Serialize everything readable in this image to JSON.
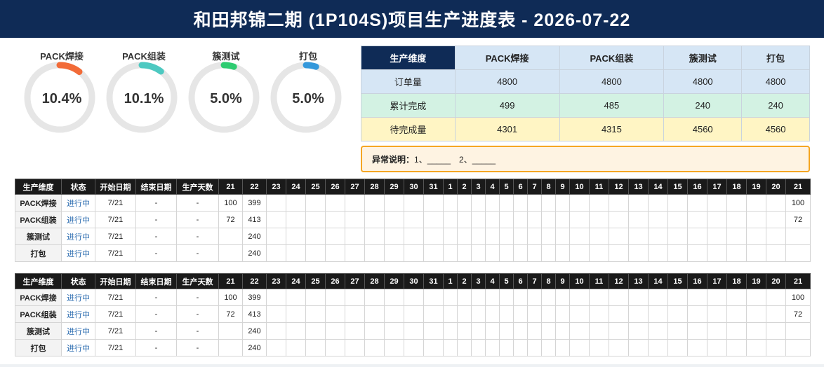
{
  "title": "和田邦锦二期 (1P104S)项目生产进度表 - 2026-07-22",
  "gauges": [
    {
      "label": "PACK焊接",
      "value": "10.4%",
      "fraction": 0.104,
      "color": "#f26b38"
    },
    {
      "label": "PACK组装",
      "value": "10.1%",
      "fraction": 0.101,
      "color": "#4dc9c1"
    },
    {
      "label": "簇测试",
      "value": "5.0%",
      "fraction": 0.05,
      "color": "#2ecc71"
    },
    {
      "label": "打包",
      "value": "5.0%",
      "fraction": 0.05,
      "color": "#3498db"
    }
  ],
  "summary": {
    "headers": [
      "生产维度",
      "PACK焊接",
      "PACK组装",
      "簇测试",
      "打包"
    ],
    "rows": [
      [
        "订单量",
        "4800",
        "4800",
        "4800",
        "4800"
      ],
      [
        "累计完成",
        "499",
        "485",
        "240",
        "240"
      ],
      [
        "待完成量",
        "4301",
        "4315",
        "4560",
        "4560"
      ]
    ]
  },
  "note": {
    "label": "异常说明：",
    "text": "1、_____　2、_____"
  },
  "detail_headers": [
    "生产维度",
    "状态",
    "开始日期",
    "结束日期",
    "生产天数"
  ],
  "days": [
    "21",
    "22",
    "23",
    "24",
    "25",
    "26",
    "27",
    "28",
    "29",
    "30",
    "31",
    "1",
    "2",
    "3",
    "4",
    "5",
    "6",
    "7",
    "8",
    "9",
    "10",
    "11",
    "12",
    "13",
    "14",
    "15",
    "16",
    "17",
    "18",
    "19",
    "20",
    "21"
  ],
  "tables": [
    {
      "rows": [
        {
          "dim": "PACK焊接",
          "status": "进行中",
          "start": "7/21",
          "end": "-",
          "days": "-",
          "cells": [
            "100",
            "399",
            "",
            "",
            "",
            "",
            "",
            "",
            "",
            "",
            "",
            "",
            "",
            "",
            "",
            "",
            "",
            "",
            "",
            "",
            "",
            "",
            "",
            "",
            "",
            "",
            "",
            "",
            "",
            "",
            "",
            "100"
          ]
        },
        {
          "dim": "PACK组装",
          "status": "进行中",
          "start": "7/21",
          "end": "-",
          "days": "-",
          "cells": [
            "72",
            "413",
            "",
            "",
            "",
            "",
            "",
            "",
            "",
            "",
            "",
            "",
            "",
            "",
            "",
            "",
            "",
            "",
            "",
            "",
            "",
            "",
            "",
            "",
            "",
            "",
            "",
            "",
            "",
            "",
            "",
            "72"
          ]
        },
        {
          "dim": "簇测试",
          "status": "进行中",
          "start": "7/21",
          "end": "-",
          "days": "-",
          "cells": [
            "",
            "240",
            "",
            "",
            "",
            "",
            "",
            "",
            "",
            "",
            "",
            "",
            "",
            "",
            "",
            "",
            "",
            "",
            "",
            "",
            "",
            "",
            "",
            "",
            "",
            "",
            "",
            "",
            "",
            "",
            "",
            ""
          ]
        },
        {
          "dim": "打包",
          "status": "进行中",
          "start": "7/21",
          "end": "-",
          "days": "-",
          "cells": [
            "",
            "240",
            "",
            "",
            "",
            "",
            "",
            "",
            "",
            "",
            "",
            "",
            "",
            "",
            "",
            "",
            "",
            "",
            "",
            "",
            "",
            "",
            "",
            "",
            "",
            "",
            "",
            "",
            "",
            "",
            "",
            ""
          ]
        }
      ]
    },
    {
      "rows": [
        {
          "dim": "PACK焊接",
          "status": "进行中",
          "start": "7/21",
          "end": "-",
          "days": "-",
          "cells": [
            "100",
            "399",
            "",
            "",
            "",
            "",
            "",
            "",
            "",
            "",
            "",
            "",
            "",
            "",
            "",
            "",
            "",
            "",
            "",
            "",
            "",
            "",
            "",
            "",
            "",
            "",
            "",
            "",
            "",
            "",
            "",
            "100"
          ]
        },
        {
          "dim": "PACK组装",
          "status": "进行中",
          "start": "7/21",
          "end": "-",
          "days": "-",
          "cells": [
            "72",
            "413",
            "",
            "",
            "",
            "",
            "",
            "",
            "",
            "",
            "",
            "",
            "",
            "",
            "",
            "",
            "",
            "",
            "",
            "",
            "",
            "",
            "",
            "",
            "",
            "",
            "",
            "",
            "",
            "",
            "",
            "72"
          ]
        },
        {
          "dim": "簇测试",
          "status": "进行中",
          "start": "7/21",
          "end": "-",
          "days": "-",
          "cells": [
            "",
            "240",
            "",
            "",
            "",
            "",
            "",
            "",
            "",
            "",
            "",
            "",
            "",
            "",
            "",
            "",
            "",
            "",
            "",
            "",
            "",
            "",
            "",
            "",
            "",
            "",
            "",
            "",
            "",
            "",
            "",
            ""
          ]
        },
        {
          "dim": "打包",
          "status": "进行中",
          "start": "7/21",
          "end": "-",
          "days": "-",
          "cells": [
            "",
            "240",
            "",
            "",
            "",
            "",
            "",
            "",
            "",
            "",
            "",
            "",
            "",
            "",
            "",
            "",
            "",
            "",
            "",
            "",
            "",
            "",
            "",
            "",
            "",
            "",
            "",
            "",
            "",
            "",
            "",
            ""
          ]
        }
      ]
    }
  ]
}
